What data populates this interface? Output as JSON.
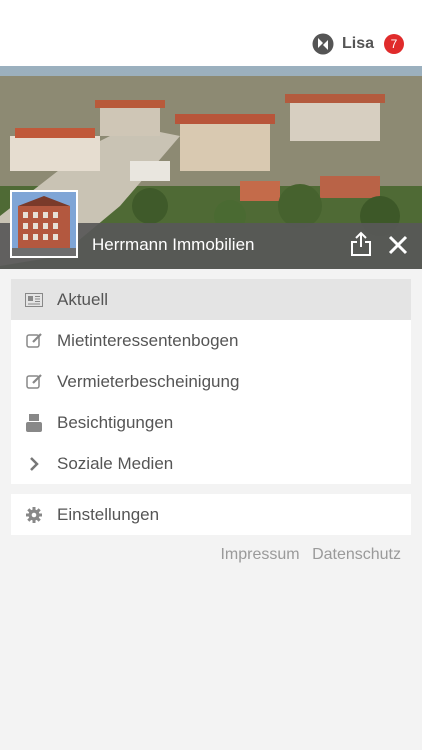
{
  "header": {
    "user_name": "Lisa",
    "notification_count": "7",
    "badge_color": "#e02b2b"
  },
  "banner": {
    "title": "Herrmann Immobilien"
  },
  "menu": {
    "items": [
      {
        "label": "Aktuell",
        "icon": "newspaper-icon",
        "active": true
      },
      {
        "label": "Mietinteressentenbogen",
        "icon": "edit-icon"
      },
      {
        "label": "Vermieterbescheinigung",
        "icon": "edit-icon"
      },
      {
        "label": "Besichtigungen",
        "icon": "youtube-icon"
      },
      {
        "label": "Soziale Medien",
        "icon": "chevron-right-icon"
      }
    ],
    "settings_label": "Einstellungen"
  },
  "footer": {
    "impressum": "Impressum",
    "datenschutz": "Datenschutz"
  }
}
